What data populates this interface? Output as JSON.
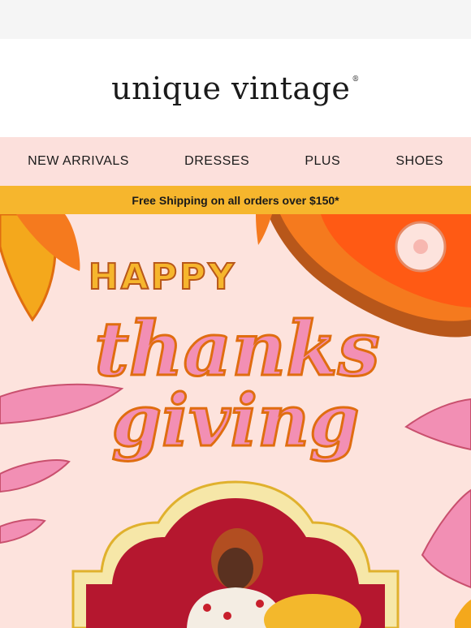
{
  "brand": {
    "name": "unique vintage",
    "mark": "®"
  },
  "nav": {
    "items": [
      {
        "label": "NEW ARRIVALS"
      },
      {
        "label": "DRESSES"
      },
      {
        "label": "PLUS"
      },
      {
        "label": "SHOES"
      }
    ]
  },
  "promo": {
    "shipping_text": "Free Shipping on all orders over $150*"
  },
  "hero": {
    "line1": "HAPPY",
    "line2": "thanks",
    "line3": "giving",
    "colors": {
      "background": "#fde3dd",
      "pink": "#f28fb4",
      "orange": "#f57a1e",
      "gold": "#f6b62d",
      "curtain": "#b5172f"
    }
  }
}
